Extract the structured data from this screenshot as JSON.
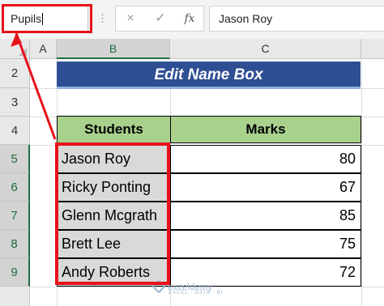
{
  "formula_bar": {
    "name_box_value": "Pupils",
    "dots_icon": "vertical-ellipsis",
    "cancel_icon": "×",
    "enter_icon": "✓",
    "fx_label": "fx",
    "formula_value": "Jason Roy"
  },
  "grid": {
    "columns": [
      "A",
      "B",
      "C"
    ],
    "rows": [
      "2",
      "3",
      "4",
      "5",
      "6",
      "7",
      "8",
      "9"
    ],
    "selected_column": "B",
    "selected_rows": [
      "5",
      "6",
      "7",
      "8",
      "9"
    ]
  },
  "sheet": {
    "title": "Edit Name Box",
    "headers": {
      "students": "Students",
      "marks": "Marks"
    },
    "records": [
      {
        "student": "Jason Roy",
        "mark": "80"
      },
      {
        "student": "Ricky Ponting",
        "mark": "67"
      },
      {
        "student": "Glenn Mcgrath",
        "mark": "85"
      },
      {
        "student": "Brett Lee",
        "mark": "75"
      },
      {
        "student": "Andy Roberts",
        "mark": "72"
      }
    ]
  },
  "watermark": {
    "brand": "exceldemy",
    "tagline": "EXCEL · DATA · BI"
  },
  "colors": {
    "highlight": "#e8121a",
    "title_bg": "#2f4f94",
    "header_bg": "#a9d18e",
    "selected_cell_bg": "#d9d9d9",
    "excel_green": "#1e7145"
  }
}
